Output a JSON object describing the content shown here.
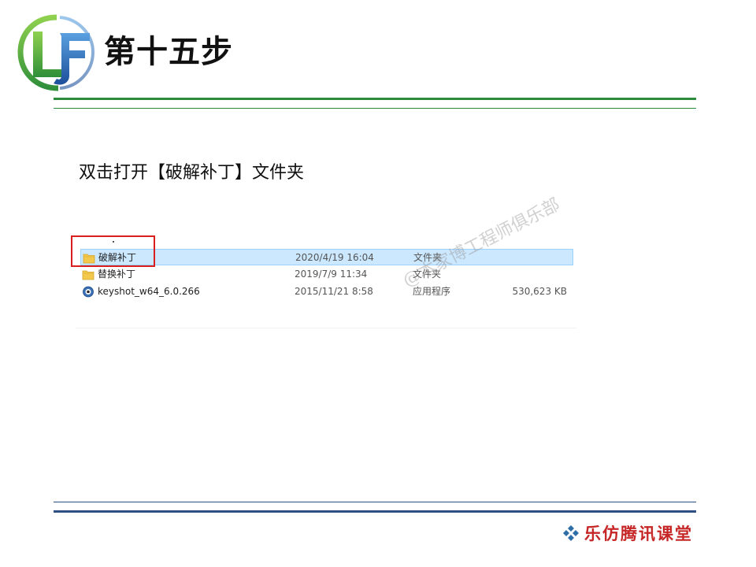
{
  "slide": {
    "title": "第十五步",
    "logo_text": "LF",
    "instruction": "双击打开【破解补丁】文件夹"
  },
  "explorer": {
    "files": [
      {
        "name": "破解补丁",
        "modified": "2020/4/19 16:04",
        "type": "文件夹",
        "size": "",
        "icon": "folder-icon",
        "selected": true
      },
      {
        "name": "替换补丁",
        "modified": "2019/7/9 11:34",
        "type": "文件夹",
        "size": "",
        "icon": "folder-icon",
        "selected": false
      },
      {
        "name": "keyshot_w64_6.0.266",
        "modified": "2015/11/21 8:58",
        "type": "应用程序",
        "size": "530,623 KB",
        "icon": "keyshot-app-icon",
        "selected": false
      }
    ],
    "watermark": "@本家博工程师俱乐部"
  },
  "footer": {
    "brand": "乐仿腾讯课堂",
    "icon": "diamond-cluster-icon"
  },
  "colors": {
    "accent_green": "#2e8b3d",
    "accent_blue": "#2f4f82",
    "highlight_red": "#d81e1e",
    "brand_red": "#c62626",
    "selection_bg": "#cce8ff"
  }
}
